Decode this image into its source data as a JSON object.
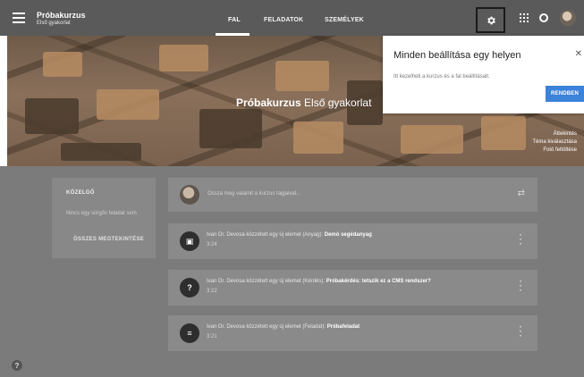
{
  "header": {
    "course_title": "Próbakurzus",
    "course_subtitle": "Első gyakorlat",
    "tabs": [
      {
        "label": "FAL",
        "active": true
      },
      {
        "label": "FELADATOK",
        "active": false
      },
      {
        "label": "SZEMÉLYEK",
        "active": false
      }
    ],
    "icons": [
      "menu-icon",
      "gear-icon",
      "apps-icon",
      "notifications-icon",
      "account-avatar"
    ]
  },
  "banner": {
    "title": "Próbakurzus",
    "subtitle": "Első gyakorlat",
    "links": [
      "Áttekintés",
      "Téma kiválasztása",
      "Fotó feltöltése"
    ]
  },
  "upcoming": {
    "title": "KÖZELGŐ",
    "empty_text": "Nincs egy sürgős feladat sem",
    "view_all": "ÖSSZES MEGTEKINTÉSE"
  },
  "composer": {
    "placeholder": "Ossza meg valamit a kurzus tagjaival..."
  },
  "stream": [
    {
      "icon": "material-icon",
      "text": "Ivan Dr. Devosa közzétett egy új elemet (Anyag): ",
      "item": "Demó segédanyag",
      "time": "3:24"
    },
    {
      "icon": "question-icon",
      "text": "Ivan Dr. Devosa közzétett egy új elemet (Kérdés): ",
      "item": "Próbakérdés: tetszik ez a CMS rendszer?",
      "time": "3:22"
    },
    {
      "icon": "assignment-icon",
      "text": "Ivan Dr. Devosa közzétett egy új elemet (Feladat): ",
      "item": "Próbafeladat",
      "time": "3:21"
    }
  ],
  "popup": {
    "title": "Minden beállítása egy helyen",
    "body": "Itt kezelheti a kurzus és a fal beállításait.",
    "button": "RENDBEN"
  },
  "colors": {
    "topbar": "#5a5a5a",
    "accent_button": "#3b82d8",
    "overlay": "#7b7b7b"
  }
}
